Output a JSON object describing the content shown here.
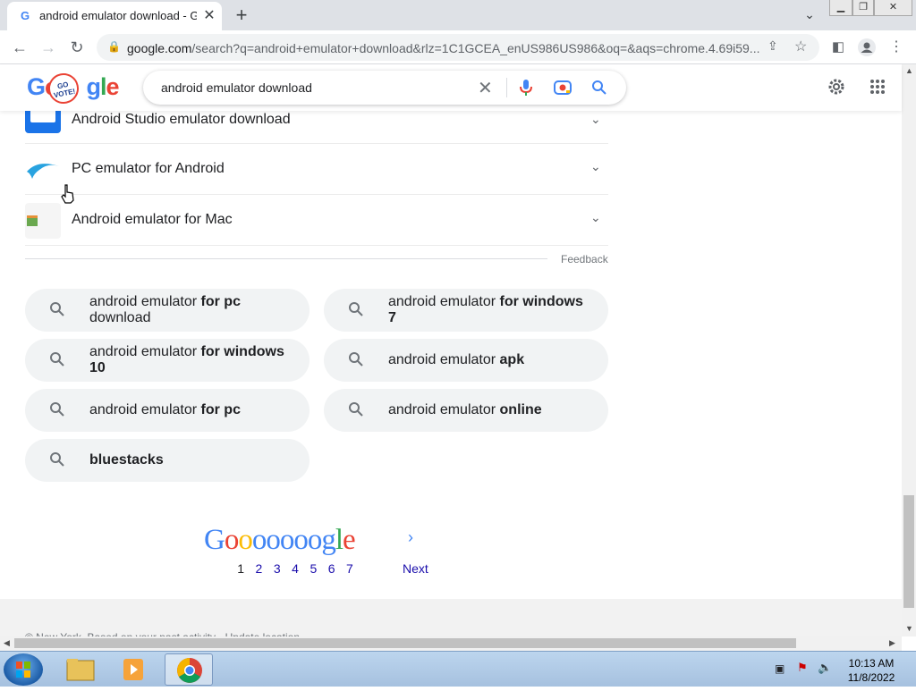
{
  "browser": {
    "tab_title": "android emulator download - Go",
    "tab_favicon": "G",
    "url_host": "google.com",
    "url_rest": "/search?q=android+emulator+download&rlz=1C1GCEA_enUS986US986&oq=&aqs=chrome.4.69i59..."
  },
  "google": {
    "search_query": "android emulator download",
    "doodle_text": "GO VOTE!"
  },
  "people_also_search": [
    {
      "label": "Android Studio emulator download"
    },
    {
      "label": "PC emulator for Android"
    },
    {
      "label": "Android emulator for Mac"
    }
  ],
  "feedback_label": "Feedback",
  "related_searches": [
    {
      "prefix": "android emulator ",
      "bold": "for pc",
      "suffix": "download"
    },
    {
      "prefix": "android emulator ",
      "bold": "for windows",
      "suffix": "7"
    },
    {
      "prefix": "android emulator ",
      "bold": "for windows",
      "suffix": "10"
    },
    {
      "prefix": "android emulator ",
      "bold": "apk",
      "suffix": ""
    },
    {
      "prefix": "android emulator ",
      "bold": "for pc",
      "suffix": ""
    },
    {
      "prefix": "android emulator ",
      "bold": "online",
      "suffix": ""
    },
    {
      "prefix": "",
      "bold": "bluestacks",
      "suffix": ""
    }
  ],
  "pagination": {
    "pages": [
      "1",
      "2",
      "3",
      "4",
      "5",
      "6",
      "7"
    ],
    "current": "1",
    "next_label": "Next"
  },
  "footer_cut_text": "© New York, Based on your past activity - Update location",
  "taskbar": {
    "time": "10:13 AM",
    "date": "11/8/2022"
  },
  "colors": {
    "google_blue": "#4285f4",
    "google_red": "#ea4335",
    "google_yellow": "#fbbc05",
    "google_green": "#34a853",
    "link_blue": "#1a0dab"
  }
}
